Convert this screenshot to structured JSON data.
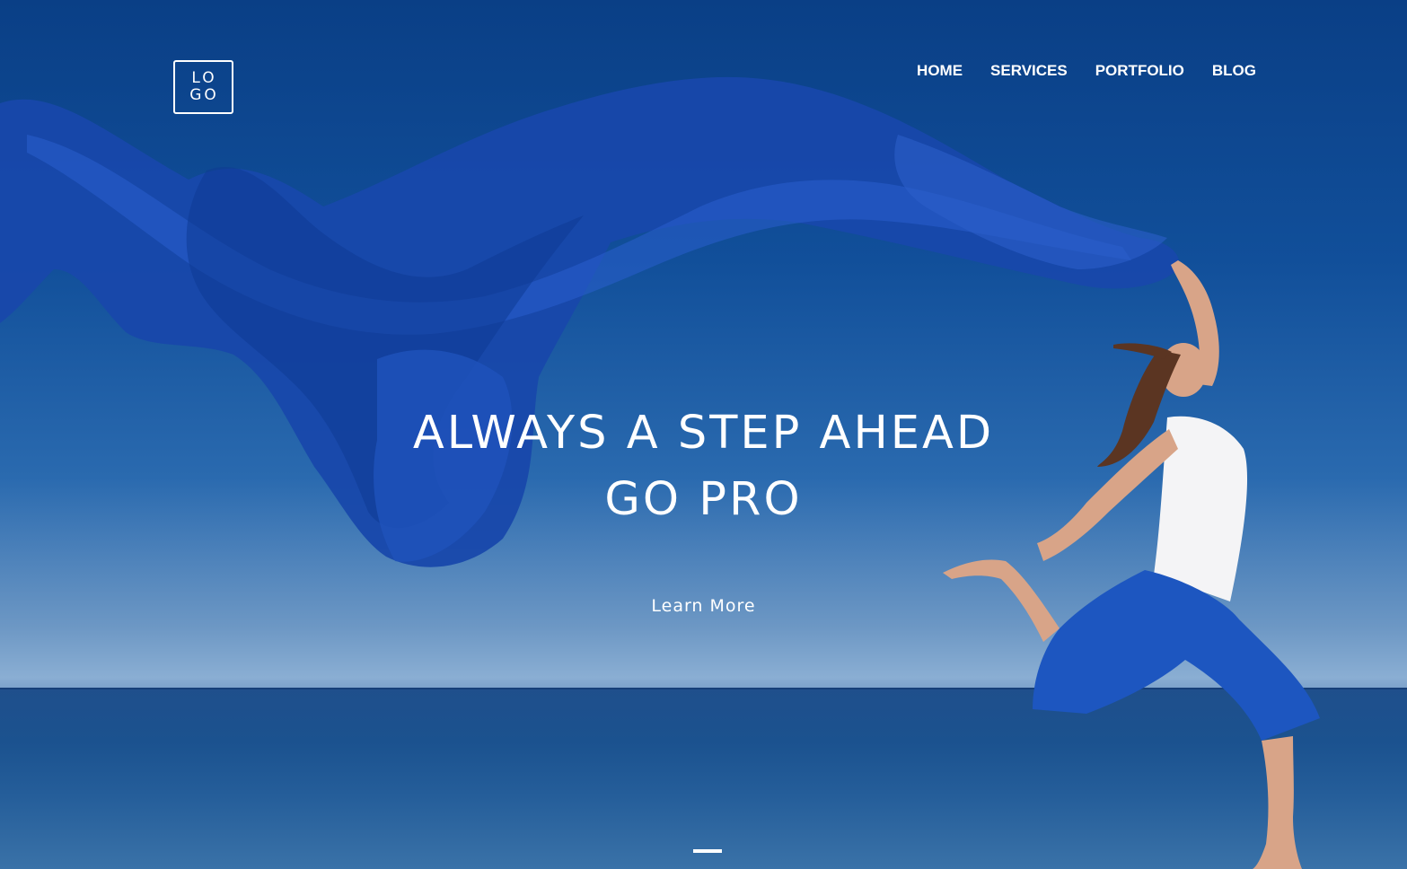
{
  "logo": {
    "line1": "LO",
    "line2": "GO"
  },
  "nav": {
    "items": [
      {
        "label": "HOME"
      },
      {
        "label": "SERVICES"
      },
      {
        "label": "PORTFOLIO"
      },
      {
        "label": "BLOG"
      }
    ]
  },
  "hero": {
    "headline_line1": "ALWAYS A STEP AHEAD",
    "headline_line2": "GO PRO",
    "cta_label": "Learn More"
  },
  "colors": {
    "sky_top": "#0a3f86",
    "sky_horizon": "#8aaed3",
    "sea": "#1f4f8c",
    "fabric": "#1a49b0",
    "text": "#ffffff"
  }
}
